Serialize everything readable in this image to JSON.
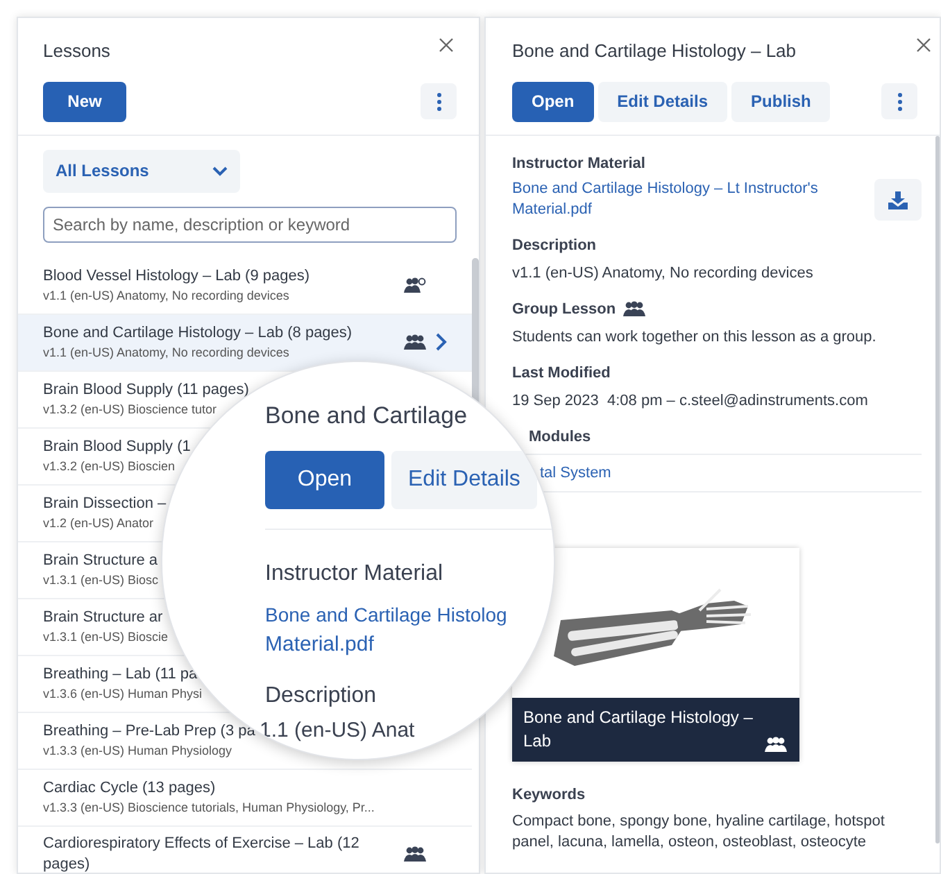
{
  "lessons_panel": {
    "title": "Lessons",
    "new_button": "New",
    "filter": "All Lessons",
    "search": {
      "placeholder": "Search by name, description or keyword"
    },
    "items": [
      {
        "title": "Blood Vessel Histology – Lab (9 pages)",
        "subtitle": "v1.1 (en-US) Anatomy, No recording devices",
        "kind": "shared",
        "selected": false
      },
      {
        "title": "Bone and Cartilage Histology – Lab (8 pages)",
        "subtitle": "v1.1 (en-US) Anatomy, No recording devices",
        "kind": "group",
        "selected": true
      },
      {
        "title": "Brain Blood Supply (11 pages)",
        "subtitle": "v1.3.2 (en-US) Bioscience tutor",
        "selected": false
      },
      {
        "title": "Brain Blood Supply (1",
        "subtitle": "v1.3.2 (en-US) Bioscien",
        "selected": false
      },
      {
        "title": "Brain Dissection –",
        "subtitle": "v1.2 (en-US) Anator",
        "selected": false
      },
      {
        "title": "Brain Structure a",
        "subtitle": "v1.3.1 (en-US) Biosc",
        "selected": false
      },
      {
        "title": "Brain Structure ar",
        "subtitle": "v1.3.1 (en-US) Bioscie",
        "selected": false
      },
      {
        "title": "Breathing – Lab (11 pa",
        "subtitle": "v1.3.6 (en-US) Human Physi",
        "selected": false
      },
      {
        "title": "Breathing – Pre-Lab Prep (3 pa",
        "subtitle": "v1.3.3 (en-US) Human Physiology",
        "selected": false
      },
      {
        "title": "Cardiac Cycle (13 pages)",
        "subtitle": "v1.3.3 (en-US) Bioscience tutorials, Human Physiology, Pr...",
        "selected": false
      },
      {
        "title": "Cardiorespiratory Effects of Exercise – Lab (12 pages)",
        "kind": "group",
        "selected": false
      }
    ]
  },
  "detail_panel": {
    "title": "Bone and Cartilage Histology – Lab",
    "buttons": [
      {
        "label": "Open",
        "selected": true
      },
      {
        "label": "Edit Details",
        "selected": false
      },
      {
        "label": "Publish",
        "selected": false
      }
    ],
    "sections": [
      {
        "kind": "link",
        "heading": "Instructor Material",
        "text": "Bone and Cartilage Histology – Lt Instructor's Material.pdf"
      },
      {
        "kind": "text",
        "heading": "Description",
        "text": "v1.1 (en-US) Anatomy, No recording devices"
      },
      {
        "kind": "group",
        "heading": "Group Lesson",
        "text": "Students can work together on this lesson as a group."
      },
      {
        "kind": "text",
        "heading": "Last Modified",
        "text": "19 Sep 2023  4:08 pm – c.steel@adinstruments.com"
      },
      {
        "kind": "text",
        "heading": "Modules",
        "text": "tal System"
      }
    ],
    "card": {
      "caption": "Bone and Cartilage Histology – Lab"
    },
    "keywords": {
      "heading": "Keywords",
      "text": "Compact bone, spongy bone, hyaline cartilage, hotspot panel, lacuna, lamella, osteon, osteoblast, osteocyte"
    }
  },
  "magnifier": {
    "title": "Bone and Cartilage",
    "buttons": [
      {
        "label": "Open",
        "selected": true
      },
      {
        "label": "Edit Details",
        "selected": false
      }
    ],
    "heading_1": "Instructor Material",
    "link": "Bone and Cartilage Histolog",
    "link_line_2": "Material.pdf",
    "heading_2": "Description",
    "text": "1.1 (en-US) Anat"
  }
}
